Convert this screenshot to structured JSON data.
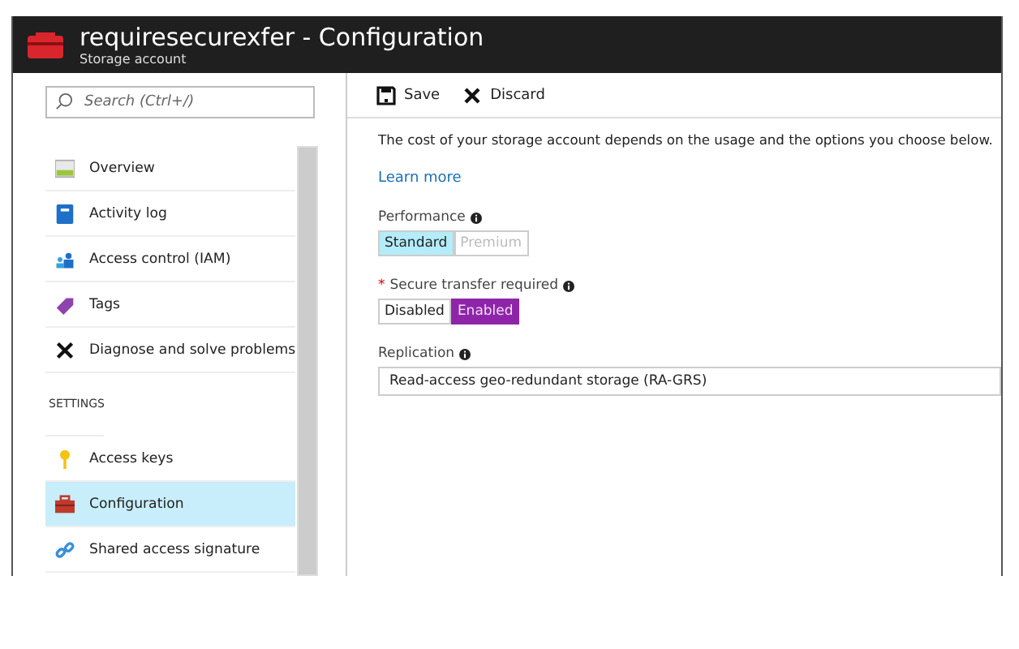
{
  "header": {
    "title": "requiresecurexfer - Configuration",
    "subtitle": "Storage account"
  },
  "sidebar": {
    "search": {
      "placeholder": "Search (Ctrl+/)"
    },
    "items": [
      {
        "label": "Overview",
        "selected": false
      },
      {
        "label": "Activity log",
        "selected": false
      },
      {
        "label": "Access control (IAM)",
        "selected": false
      },
      {
        "label": "Tags",
        "selected": false
      },
      {
        "label": "Diagnose and solve problems",
        "selected": false
      }
    ],
    "section": "SETTINGS",
    "settings_items": [
      {
        "label": "Access keys",
        "selected": false
      },
      {
        "label": "Configuration",
        "selected": true
      },
      {
        "label": "Shared access signature",
        "selected": false
      }
    ]
  },
  "toolbar": [
    {
      "label": "Save"
    },
    {
      "label": "Discard"
    }
  ],
  "description": "The cost of your storage account depends on the usage and the options you choose below.",
  "learn_more": "Learn more",
  "fields": [
    {
      "kind": "toggle",
      "label": "Performance",
      "options": [
        {
          "label": "Standard",
          "selected": true
        },
        {
          "label": "Premium",
          "selected": false
        }
      ]
    },
    {
      "kind": "toggle",
      "label": "Secure transfer required",
      "required_mark": "*",
      "options": [
        {
          "label": "Disabled",
          "selected": false
        },
        {
          "label": "Enabled",
          "selected": true
        }
      ]
    },
    {
      "kind": "select",
      "label": "Replication",
      "value": "Read-access geo-redundant storage (RA-GRS)"
    }
  ]
}
